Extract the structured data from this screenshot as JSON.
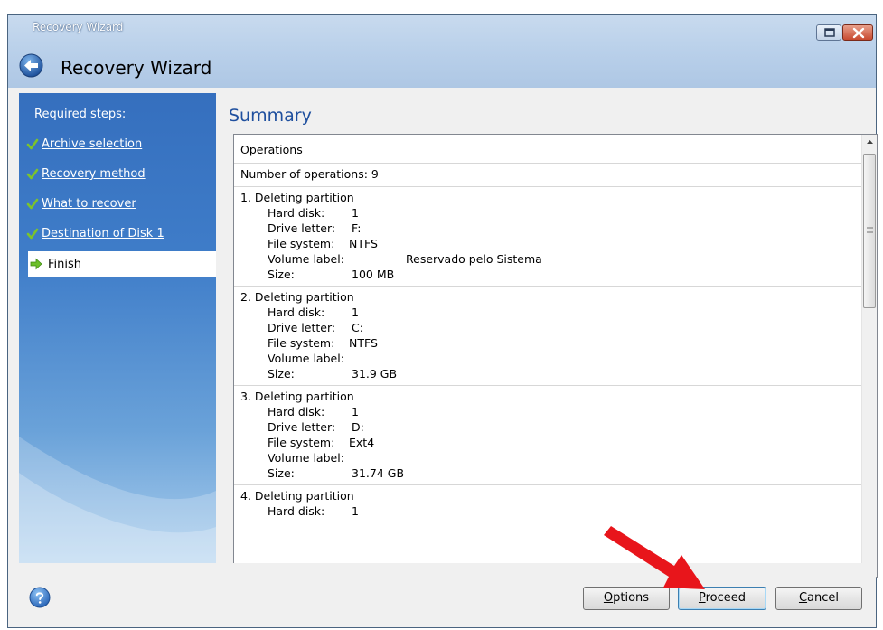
{
  "window": {
    "title_small": "Recovery Wizard",
    "title_large": "Recovery Wizard"
  },
  "sidebar": {
    "header": "Required steps:",
    "steps": [
      {
        "label": "Archive selection",
        "state": "done"
      },
      {
        "label": "Recovery method",
        "state": "done"
      },
      {
        "label": "What to recover",
        "state": "done"
      },
      {
        "label": "Destination of Disk 1",
        "state": "done"
      },
      {
        "label": "Finish",
        "state": "current"
      }
    ]
  },
  "main": {
    "heading": "Summary",
    "summary": {
      "operations_label": "Operations",
      "count_line": "Number of operations: 9",
      "ops": [
        {
          "title": "1. Deleting partition",
          "hard_disk_label": "Hard disk:",
          "hard_disk": "1",
          "drive_letter_label": "Drive letter:",
          "drive_letter": "F:",
          "fs_label": "File system:",
          "fs": "NTFS",
          "volume_label_label": "Volume label:",
          "volume_label": "Reservado pelo Sistema",
          "size_label": "Size:",
          "size": "100 MB"
        },
        {
          "title": "2. Deleting partition",
          "hard_disk_label": "Hard disk:",
          "hard_disk": "1",
          "drive_letter_label": "Drive letter:",
          "drive_letter": "C:",
          "fs_label": "File system:",
          "fs": "NTFS",
          "volume_label_label": "Volume label:",
          "volume_label": "",
          "size_label": "Size:",
          "size": "31.9 GB"
        },
        {
          "title": "3. Deleting partition",
          "hard_disk_label": "Hard disk:",
          "hard_disk": "1",
          "drive_letter_label": "Drive letter:",
          "drive_letter": "D:",
          "fs_label": "File system:",
          "fs": "Ext4",
          "volume_label_label": "Volume label:",
          "volume_label": "",
          "size_label": "Size:",
          "size": "31.74 GB"
        },
        {
          "title": "4. Deleting partition",
          "hard_disk_label": "Hard disk:",
          "hard_disk": "1"
        }
      ]
    }
  },
  "buttons": {
    "options": {
      "pre": "",
      "key": "O",
      "post": "ptions"
    },
    "proceed": {
      "pre": "",
      "key": "P",
      "post": "roceed"
    },
    "cancel": {
      "pre": "",
      "key": "C",
      "post": "ancel"
    }
  },
  "icons": {
    "back": "back-arrow-icon",
    "restore": "restore-icon",
    "close": "close-icon",
    "check": "check-icon",
    "current": "arrow-right-icon",
    "help": "help-icon",
    "annotation": "red-arrow-annotation"
  },
  "colors": {
    "heading": "#1e4f9e",
    "sidebar_top": "#356fbe",
    "check": "#7cc42a",
    "annotation": "#e8151b"
  }
}
